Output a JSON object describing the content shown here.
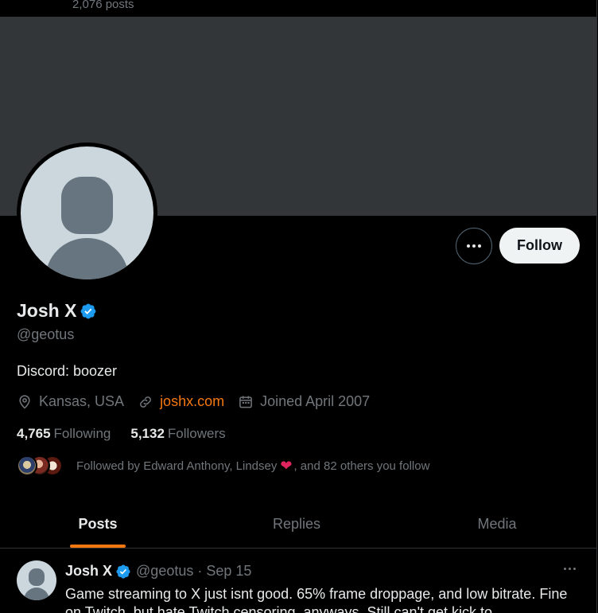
{
  "topbar": {
    "posts_count": "2,076 posts"
  },
  "profile": {
    "name": "Josh X",
    "handle": "@geotus",
    "bio": "Discord: boozer",
    "location": "Kansas, USA",
    "website": "joshx.com",
    "joined": "Joined April 2007",
    "following_count": "4,765",
    "following_label": "Following",
    "followers_count": "5,132",
    "followers_label": "Followers",
    "followed_by_prefix": "Followed by Edward Anthony, Lindsey",
    "followed_by_suffix": ", and 82 others you follow"
  },
  "actions": {
    "follow_label": "Follow",
    "more_icon": "more-icon"
  },
  "tabs": [
    {
      "label": "Posts",
      "active": true
    },
    {
      "label": "Replies",
      "active": false
    },
    {
      "label": "Media",
      "active": false
    }
  ],
  "tweet": {
    "name": "Josh X",
    "handle_time": "@geotus · Sep 15",
    "text": "Game streaming to X just isnt good. 65% frame droppage, and low bitrate. Fine on Twitch, but hate Twitch censoring, anyways. Still can't get kick to"
  },
  "colors": {
    "accent": "#f4780f",
    "verified": "#1d9bf0",
    "banner": "#333639",
    "follow_bg": "#eff3f4"
  }
}
